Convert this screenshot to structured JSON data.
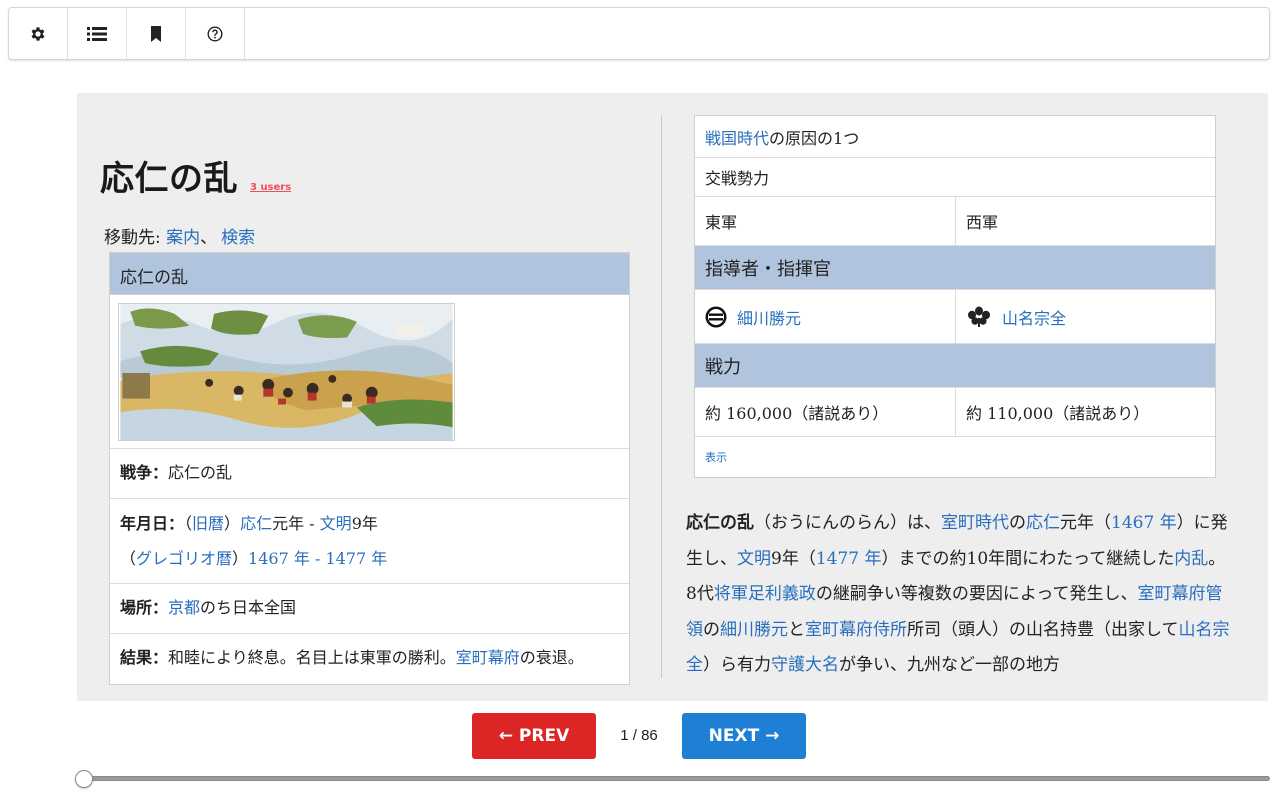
{
  "toolbar": {
    "buttons": [
      {
        "icon": "gear-icon"
      },
      {
        "icon": "list-icon"
      },
      {
        "icon": "bookmark-icon"
      },
      {
        "icon": "help-icon"
      }
    ]
  },
  "article": {
    "title": "応仁の乱",
    "users_link": "3 users",
    "nav_prefix": "移動先: ",
    "nav_link1": "案内",
    "nav_sep": "、",
    "nav_link2": "検索"
  },
  "infobox": {
    "header": "応仁の乱",
    "war_label": "戦争：",
    "war_value": "応仁の乱",
    "date_label": "年月日：",
    "date_open": "（",
    "date_kyureki": "旧暦",
    "date_close": "）",
    "date_onin": "応仁",
    "date_mid1": "元年 - ",
    "date_bunmei": "文明",
    "date_end1": "9年",
    "greg_open": "（",
    "greg_link": "グレゴリオ暦",
    "greg_close": "）",
    "greg_year1": "1467 年",
    "greg_dash": " - ",
    "greg_year2": "1477 年",
    "place_label": "場所：",
    "place_link": "京都",
    "place_rest": "のち日本全国",
    "result_label": "結果：",
    "result_text": "和睦により終息。名目上は東軍の勝利。",
    "result_link": "室町幕府",
    "result_rest": "の衰退。"
  },
  "rbox": {
    "cause_link": "戦国時代",
    "cause_rest": "の原因の1つ",
    "belligerents": "交戦勢力",
    "east": "東軍",
    "west": "西軍",
    "commanders_head": "指導者・指揮官",
    "east_commander": "細川勝元",
    "west_commander": "山名宗全",
    "strength_head": "戦力",
    "east_strength": "約 160,000（諸説あり）",
    "west_strength": "約 110,000（諸説あり）",
    "show_link": "表示"
  },
  "paragraph": {
    "s1": "応仁の乱",
    "s2": "（おうにんのらん）は、",
    "l1": "室町時代",
    "s3": "の",
    "l2": "応仁",
    "s4": "元年（",
    "l3": "1467 年",
    "s5": "）に発生し、",
    "l4": "文明",
    "s6": "9年（",
    "l5": "1477 年",
    "s7": "）までの約10年間にわたって継続した",
    "l6": "内乱",
    "s8": "。8代",
    "l7": "将軍",
    "l8": "足利義政",
    "s9": "の継嗣争い等複数の要因によって発生し、",
    "l9": "室町幕府管領",
    "s10": "の",
    "l10": "細川勝元",
    "s11": "と",
    "l11": "室町幕府侍所",
    "s12": "所司（頭人）の山名持豊（出家して",
    "l12": "山名宗全",
    "s13": "）ら有力",
    "l13": "守護大名",
    "s14": "が争い、九州など一部の地方"
  },
  "pager": {
    "prev_label": "← PREV",
    "next_label": "NEXT →",
    "count": "1 / 86"
  },
  "slider": {
    "value": 0
  }
}
